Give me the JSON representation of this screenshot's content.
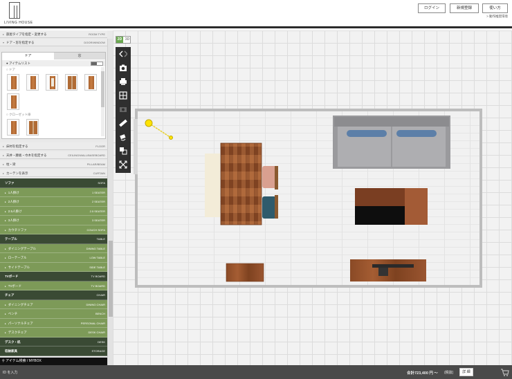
{
  "header": {
    "logo_text": "LIVING HOUSE",
    "login": "ログイン",
    "register": "新規登録",
    "usage": "使い方",
    "spec_link": "> 動作推奨環境"
  },
  "sidebar": {
    "top_rows": [
      {
        "jp": "部屋タイプを指定・変更する",
        "en": "ROOM TYPE"
      },
      {
        "jp": "ドア・窓を指定する",
        "en": "DOOR/WINDOW"
      }
    ],
    "tabs": {
      "door": "ドア",
      "window": "窓"
    },
    "item_list_label": "アイテムリスト",
    "cat_door": "ドア",
    "cat_closet": "クローゼット扉",
    "mid_rows": [
      {
        "jp": "床材を指定する",
        "en": "FLOOR"
      },
      {
        "jp": "天井・腰板・巾木を指定する",
        "en": "CEILING/WALL/BASEBOARD"
      },
      {
        "jp": "柱・梁",
        "en": "PILLAR/BEAM"
      },
      {
        "jp": "カーテンを表示",
        "en": "CURTAIN"
      }
    ],
    "groups": [
      {
        "kind": "cat",
        "jp": "ソファ",
        "en": "SOFA"
      },
      {
        "kind": "sub",
        "jp": "1人掛け",
        "en": "1 SEATER"
      },
      {
        "kind": "sub",
        "jp": "2人掛け",
        "en": "2 SEATER"
      },
      {
        "kind": "sub",
        "jp": "2.5人掛け",
        "en": "2.5 SEATER"
      },
      {
        "kind": "sub",
        "jp": "3人掛け",
        "en": "3 SEATER"
      },
      {
        "kind": "sub",
        "jp": "カウチソファ",
        "en": "COUCH SOFA"
      },
      {
        "kind": "cat",
        "jp": "テーブル",
        "en": "TABLE"
      },
      {
        "kind": "sub",
        "jp": "ダイニングテーブル",
        "en": "DINING TABLE"
      },
      {
        "kind": "sub",
        "jp": "ローテーブル",
        "en": "LOW TABLE"
      },
      {
        "kind": "sub",
        "jp": "サイドテーブル",
        "en": "SIDE TABLE"
      },
      {
        "kind": "cat",
        "jp": "TVボード",
        "en": "TV BOARD"
      },
      {
        "kind": "sub",
        "jp": "TVボード",
        "en": "TV BOARD"
      },
      {
        "kind": "cat",
        "jp": "チェア",
        "en": "CHAIR"
      },
      {
        "kind": "sub",
        "jp": "ダイニングチェア",
        "en": "DINING CHAIR"
      },
      {
        "kind": "sub",
        "jp": "ベンチ",
        "en": "BENCH"
      },
      {
        "kind": "sub",
        "jp": "パーソナルチェア",
        "en": "PERSONAL CHAIR"
      },
      {
        "kind": "sub",
        "jp": "デスクチェア",
        "en": "DESK CHAIR"
      },
      {
        "kind": "cat",
        "jp": "デスク・机",
        "en": "DESK"
      },
      {
        "kind": "cat",
        "jp": "収納家具",
        "en": "STORAGE"
      }
    ],
    "search_label": "アイテム検索 / MYBOX"
  },
  "canvas": {
    "mode_2d": "2D",
    "mode_3d": "3D",
    "tools": [
      "undo-redo",
      "camera-icon",
      "print-icon",
      "layout-icon",
      "photo-icon",
      "measure-icon",
      "rotate-icon",
      "copy-icon",
      "resize-icon"
    ]
  },
  "footer": {
    "inquiry": "ID を入力",
    "total_label": "合計",
    "total": "723,400 円 ～",
    "tax": "(税抜)",
    "detail": "詳 細"
  },
  "colors": {
    "category_bg": "#3a4a34",
    "sub_bg": "#7d9a58",
    "accent_green": "#6aa84f"
  }
}
